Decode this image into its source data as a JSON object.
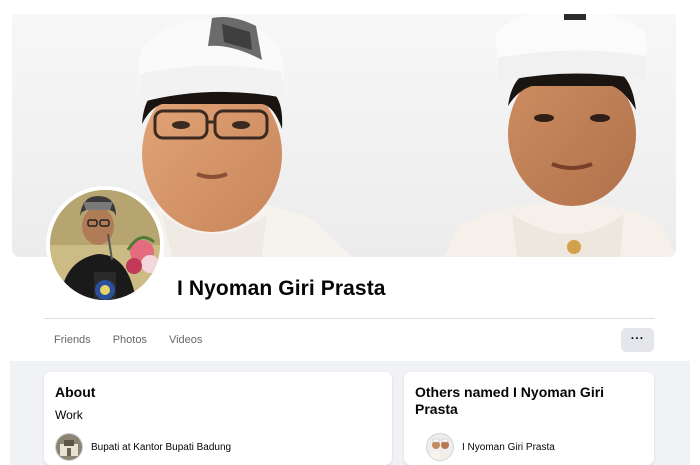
{
  "profile": {
    "name": "I Nyoman Giri Prasta"
  },
  "tabs": [
    {
      "label": "Friends"
    },
    {
      "label": "Photos"
    },
    {
      "label": "Videos"
    }
  ],
  "more_button": {
    "label": "···",
    "icon": "more-horizontal-icon"
  },
  "about": {
    "title": "About",
    "work_label": "Work",
    "work_entry": "Bupati at Kantor Bupati Badung"
  },
  "others": {
    "title": "Others named I Nyoman Giri Prasta",
    "entry": "I Nyoman Giri Prasta"
  },
  "colors": {
    "background": "#ffffff",
    "lower_bg": "#f0f2f5",
    "secondary_text": "#65676b",
    "button_bg": "#e4e6eb",
    "divider": "#dadde1"
  }
}
